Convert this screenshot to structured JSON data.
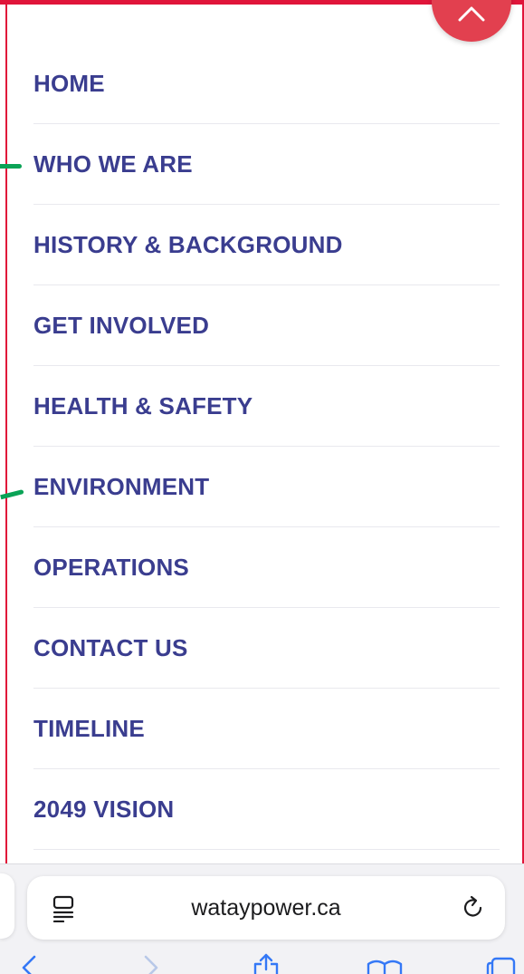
{
  "menu": {
    "items": [
      {
        "label": "HOME"
      },
      {
        "label": "WHO WE ARE"
      },
      {
        "label": "HISTORY & BACKGROUND"
      },
      {
        "label": "GET INVOLVED"
      },
      {
        "label": "HEALTH & SAFETY"
      },
      {
        "label": "ENVIRONMENT"
      },
      {
        "label": "OPERATIONS"
      },
      {
        "label": "CONTACT US"
      },
      {
        "label": "TIMELINE"
      },
      {
        "label": "2049 VISION"
      }
    ]
  },
  "browser": {
    "url": "wataypower.ca"
  },
  "icons": {
    "close": "chevron-up-icon",
    "reader": "reader-mode-icon",
    "reload": "reload-icon",
    "back": "chevron-left-icon",
    "forward": "chevron-right-icon",
    "share": "share-icon",
    "bookmarks": "book-icon",
    "tabs": "tabs-icon"
  },
  "colors": {
    "menu_text": "#3a3d8f",
    "accent_red": "#e2404f",
    "accent_green": "#0aa356"
  }
}
